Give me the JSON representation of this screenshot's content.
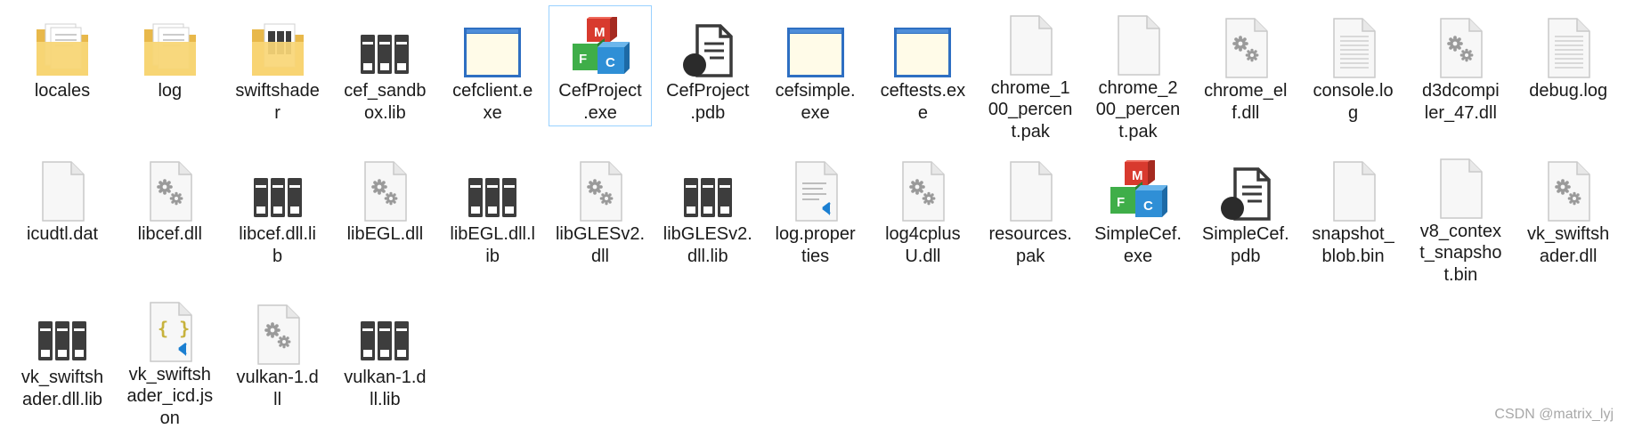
{
  "watermark": "CSDN @matrix_lyj",
  "files": [
    {
      "name": "locales",
      "lines": "locales",
      "icon": "folder-docs-icon",
      "selected": false
    },
    {
      "name": "log",
      "lines": "log",
      "icon": "folder-docs-icon",
      "selected": false
    },
    {
      "name": "swiftshader",
      "lines": "swiftshade\nr",
      "icon": "folder-library-icon",
      "selected": false
    },
    {
      "name": "cef_sandbox.lib",
      "lines": "cef_sandb\nox.lib",
      "icon": "library-icon",
      "selected": false
    },
    {
      "name": "cefclient.exe",
      "lines": "cefclient.e\nxe",
      "icon": "window-exe-icon",
      "selected": false
    },
    {
      "name": "CefProject.exe",
      "lines": "CefProject\n.exe",
      "icon": "mfc-cubes-icon",
      "selected": true
    },
    {
      "name": "CefProject.pdb",
      "lines": "CefProject\n.pdb",
      "icon": "pdb-icon",
      "selected": false
    },
    {
      "name": "cefsimple.exe",
      "lines": "cefsimple.\nexe",
      "icon": "window-exe-icon",
      "selected": false
    },
    {
      "name": "ceftests.exe",
      "lines": "ceftests.ex\ne",
      "icon": "window-exe-icon",
      "selected": false
    },
    {
      "name": "chrome_100_percent.pak",
      "lines": "chrome_1\n00_percen\nt.pak",
      "icon": "blank-file-icon",
      "selected": false
    },
    {
      "name": "chrome_200_percent.pak",
      "lines": "chrome_2\n00_percen\nt.pak",
      "icon": "blank-file-icon",
      "selected": false
    },
    {
      "name": "chrome_elf.dll",
      "lines": "chrome_el\nf.dll",
      "icon": "dll-gears-icon",
      "selected": false
    },
    {
      "name": "console.log",
      "lines": "console.lo\ng",
      "icon": "text-file-icon",
      "selected": false
    },
    {
      "name": "d3dcompiler_47.dll",
      "lines": "d3dcompi\nler_47.dll",
      "icon": "dll-gears-icon",
      "selected": false
    },
    {
      "name": "debug.log",
      "lines": "debug.log",
      "icon": "text-file-icon",
      "selected": false
    },
    {
      "name": "icudtl.dat",
      "lines": "icudtl.dat",
      "icon": "blank-file-icon",
      "selected": false
    },
    {
      "name": "libcef.dll",
      "lines": "libcef.dll",
      "icon": "dll-gears-icon",
      "selected": false
    },
    {
      "name": "libcef.dll.lib",
      "lines": "libcef.dll.li\nb",
      "icon": "library-icon",
      "selected": false
    },
    {
      "name": "libEGL.dll",
      "lines": "libEGL.dll",
      "icon": "dll-gears-icon",
      "selected": false
    },
    {
      "name": "libEGL.dll.lib",
      "lines": "libEGL.dll.l\nib",
      "icon": "library-icon",
      "selected": false
    },
    {
      "name": "libGLESv2.dll",
      "lines": "libGLESv2.\ndll",
      "icon": "dll-gears-icon",
      "selected": false
    },
    {
      "name": "libGLESv2.dll.lib",
      "lines": "libGLESv2.\ndll.lib",
      "icon": "library-icon",
      "selected": false
    },
    {
      "name": "log.properties",
      "lines": "log.proper\nties",
      "icon": "vscode-file-icon",
      "selected": false
    },
    {
      "name": "log4cplusU.dll",
      "lines": "log4cplus\nU.dll",
      "icon": "dll-gears-icon",
      "selected": false
    },
    {
      "name": "resources.pak",
      "lines": "resources.\npak",
      "icon": "blank-file-icon",
      "selected": false
    },
    {
      "name": "SimpleCef.exe",
      "lines": "SimpleCef.\nexe",
      "icon": "mfc-cubes-icon",
      "selected": false
    },
    {
      "name": "SimpleCef.pdb",
      "lines": "SimpleCef.\npdb",
      "icon": "pdb-icon",
      "selected": false
    },
    {
      "name": "snapshot_blob.bin",
      "lines": "snapshot_\nblob.bin",
      "icon": "blank-file-icon",
      "selected": false
    },
    {
      "name": "v8_context_snapshot.bin",
      "lines": "v8_contex\nt_snapsho\nt.bin",
      "icon": "blank-file-icon",
      "selected": false
    },
    {
      "name": "vk_swiftshader.dll",
      "lines": "vk_swiftsh\nader.dll",
      "icon": "dll-gears-icon",
      "selected": false
    },
    {
      "name": "vk_swiftshader.dll.lib",
      "lines": "vk_swiftsh\nader.dll.lib",
      "icon": "library-icon",
      "selected": false
    },
    {
      "name": "vk_swiftshader_icd.json",
      "lines": "vk_swiftsh\nader_icd.js\non",
      "icon": "json-file-icon",
      "selected": false
    },
    {
      "name": "vulkan-1.dll",
      "lines": "vulkan-1.d\nll",
      "icon": "dll-gears-icon",
      "selected": false
    },
    {
      "name": "vulkan-1.dll.lib",
      "lines": "vulkan-1.d\nll.lib",
      "icon": "library-icon",
      "selected": false
    }
  ]
}
